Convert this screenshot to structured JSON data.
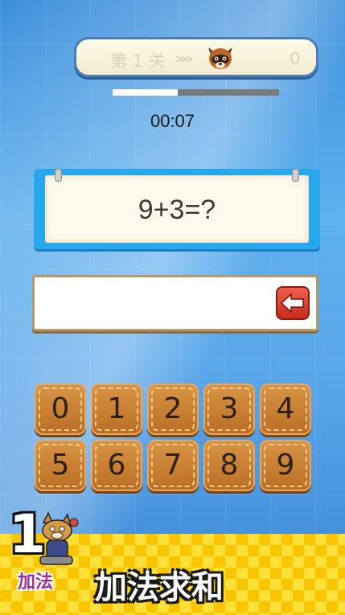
{
  "header": {
    "level_label": "第 1 关",
    "arrows": ">>>",
    "score": "0",
    "progress_fraction": 0.39
  },
  "timer": "00:07",
  "question": {
    "text": "9+3=?"
  },
  "answer": {
    "value": ""
  },
  "keypad": {
    "keys": [
      "0",
      "1",
      "2",
      "3",
      "4",
      "5",
      "6",
      "7",
      "8",
      "9"
    ]
  },
  "footer": {
    "badge_number": "1",
    "badge_label": "加法",
    "title": "加法求和"
  },
  "colors": {
    "key_face": "#c97f33",
    "banner": "#ffe038",
    "backspace": "#e0402e",
    "card": "#29a7ec"
  },
  "icons": [
    "raccoon-icon",
    "backspace-icon",
    "mascot-icon"
  ]
}
